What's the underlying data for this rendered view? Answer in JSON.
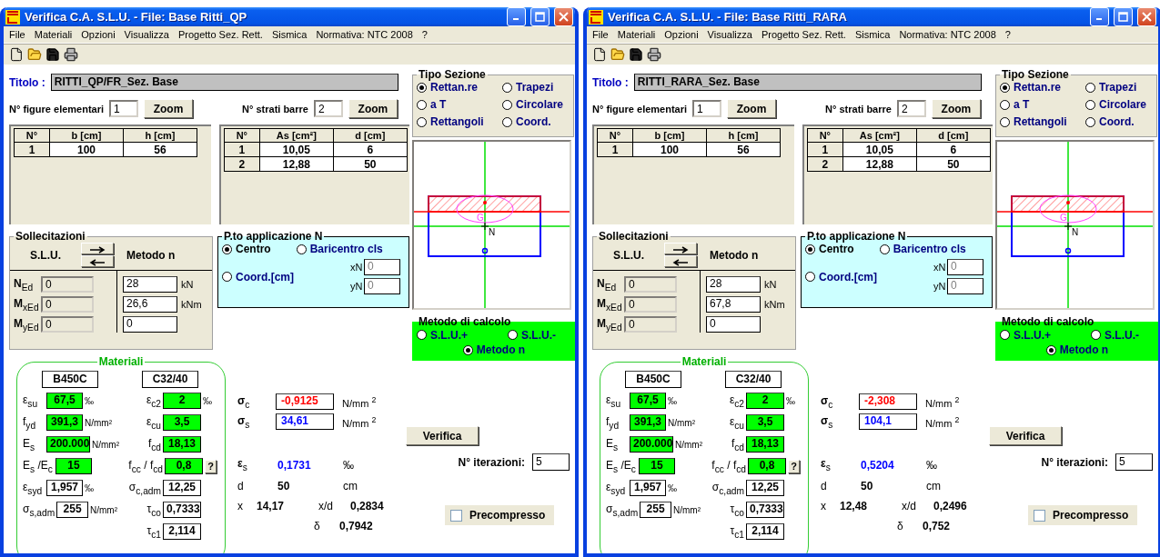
{
  "windows": [
    {
      "title": "Verifica C.A. S.L.U. - File: Base Ritti_QP",
      "menu": [
        "File",
        "Materiali",
        "Opzioni",
        "Visualizza",
        "Progetto Sez. Rett.",
        "Sismica",
        "Normativa: NTC 2008",
        "?"
      ],
      "titolo": {
        "label": "Titolo :",
        "value": "RITTI_QP/FR_Sez. Base"
      },
      "counts": [
        {
          "label": "N° figure elementari",
          "value": "1",
          "button": "Zoom"
        },
        {
          "label": "N° strati barre",
          "value": "2",
          "button": "Zoom"
        }
      ],
      "tables": [
        {
          "columns": [
            "N°",
            "b [cm]",
            "h [cm]"
          ],
          "rows": [
            [
              "1",
              "100",
              "56"
            ]
          ]
        },
        {
          "columns": [
            "N°",
            "As [cm²]",
            "d [cm]"
          ],
          "rows": [
            [
              "1",
              "10,05",
              "6"
            ],
            [
              "2",
              "12,88",
              "50"
            ]
          ]
        }
      ],
      "tipo_sezione": {
        "title": "Tipo Sezione",
        "options": [
          {
            "label": "Rettan.re",
            "selected": true
          },
          {
            "label": "Trapezi",
            "selected": false
          },
          {
            "label": "a T",
            "selected": false
          },
          {
            "label": "Circolare",
            "selected": false
          },
          {
            "label": "Rettangoli",
            "selected": false
          },
          {
            "label": "Coord.",
            "selected": false
          }
        ]
      },
      "sollecitazioni": {
        "title": "Sollecitazioni",
        "left_header": "S.L.U.",
        "right_header": "Metodo n",
        "rows": [
          {
            "label": "N$_{Ed}$",
            "slu": "0",
            "metodo": "28",
            "unit": "kN"
          },
          {
            "label": "M$_{xEd}$",
            "slu": "0",
            "metodo": "26,6",
            "unit": "kNm"
          },
          {
            "label": "M$_{yEd}$",
            "slu": "0",
            "metodo": "0"
          }
        ]
      },
      "applicazione": {
        "title": "P.to applicazione N",
        "options": [
          {
            "label": "Centro",
            "selected": true
          },
          {
            "label": "Baricentro cls",
            "selected": false
          },
          {
            "label": "Coord.[cm]",
            "selected": false
          }
        ],
        "fields": [
          {
            "label": "xN",
            "value": "0"
          },
          {
            "label": "yN",
            "value": "0"
          }
        ]
      },
      "diagram": {
        "centroid_label": "G",
        "load_label": "N"
      },
      "metodo_calcolo": {
        "title": "Metodo di calcolo",
        "options": [
          {
            "label": "S.L.U.+",
            "selected": false
          },
          {
            "label": "S.L.U.-",
            "selected": false
          },
          {
            "label": "Metodo n",
            "selected": true
          }
        ]
      },
      "materiali": {
        "title": "Materiali",
        "columns": [
          {
            "name": "B450C",
            "rows": [
              {
                "label": "ε$_{su}$",
                "value": "67,5",
                "unit": "‰",
                "highlighted": true
              },
              {
                "label": "f$_{yd}$",
                "value": "391,3",
                "unit": "N/mm²",
                "highlighted": true
              },
              {
                "label": "E$_{s}$",
                "value": "200.000",
                "unit": "N/mm²",
                "highlighted": true
              },
              {
                "label": "E$_{s}$ /E$_{c}$",
                "value": "15",
                "highlighted": true
              },
              {
                "label": "ε$_{syd}$",
                "value": "1,957",
                "unit": "‰",
                "highlighted": false
              },
              {
                "label": "σ$_{s,adm}$",
                "value": "255",
                "unit": "N/mm²",
                "highlighted": false
              }
            ]
          },
          {
            "name": "C32/40",
            "rows": [
              {
                "label": "ε$_{c2}$",
                "value": "2",
                "unit": "‰",
                "highlighted": true
              },
              {
                "label": "ε$_{cu}$",
                "value": "3,5",
                "highlighted": true
              },
              {
                "label": "f$_{cd}$",
                "value": "18,13",
                "highlighted": true
              },
              {
                "label": "f$_{cc}$ / f$_{cd}$",
                "value": "0,8",
                "help": "?",
                "highlighted": true
              },
              {
                "label": "σ$_{c,adm}$",
                "value": "12,25",
                "highlighted": false
              },
              {
                "label": "τ$_{co}$",
                "value": "0,7333",
                "highlighted": false
              },
              {
                "label": "τ$_{c1}$",
                "value": "2,114",
                "highlighted": false
              }
            ]
          }
        ]
      },
      "stresses": [
        {
          "label": "σ$_{c}$",
          "value": "-0,9125",
          "unit": "N/mm $^{2}$",
          "color": "#ff0000"
        },
        {
          "label": "σ$_{s}$",
          "value": "34,61",
          "unit": "N/mm $^{2}$",
          "color": "#0000ff"
        }
      ],
      "strain": {
        "label": "ε$_{s}$",
        "value": "0,1731",
        "unit": "‰"
      },
      "depth": {
        "label": "d",
        "value": "50",
        "unit": "cm"
      },
      "neutral_axis": {
        "label": "x",
        "value": "14,17",
        "ratio_label": "x/d",
        "ratio": "0,2834"
      },
      "delta": {
        "label": "δ",
        "value": "0,7942"
      },
      "verifica": "Verifica",
      "iterazioni": {
        "label": "N° iterazioni:",
        "value": "5"
      },
      "precompresso": {
        "label": "Precompresso",
        "checked": false
      }
    },
    {
      "title": "Verifica C.A. S.L.U. - File: Base Ritti_RARA",
      "menu": [
        "File",
        "Materiali",
        "Opzioni",
        "Visualizza",
        "Progetto Sez. Rett.",
        "Sismica",
        "Normativa: NTC 2008",
        "?"
      ],
      "titolo": {
        "label": "Titolo :",
        "value": "RITTI_RARA_Sez. Base"
      },
      "counts": [
        {
          "label": "N° figure elementari",
          "value": "1",
          "button": "Zoom"
        },
        {
          "label": "N° strati barre",
          "value": "2",
          "button": "Zoom"
        }
      ],
      "tables": [
        {
          "columns": [
            "N°",
            "b [cm]",
            "h [cm]"
          ],
          "rows": [
            [
              "1",
              "100",
              "56"
            ]
          ]
        },
        {
          "columns": [
            "N°",
            "As [cm²]",
            "d [cm]"
          ],
          "rows": [
            [
              "1",
              "10,05",
              "6"
            ],
            [
              "2",
              "12,88",
              "50"
            ]
          ]
        }
      ],
      "tipo_sezione": {
        "title": "Tipo Sezione",
        "options": [
          {
            "label": "Rettan.re",
            "selected": true
          },
          {
            "label": "Trapezi",
            "selected": false
          },
          {
            "label": "a T",
            "selected": false
          },
          {
            "label": "Circolare",
            "selected": false
          },
          {
            "label": "Rettangoli",
            "selected": false
          },
          {
            "label": "Coord.",
            "selected": false
          }
        ]
      },
      "sollecitazioni": {
        "title": "Sollecitazioni",
        "left_header": "S.L.U.",
        "right_header": "Metodo n",
        "rows": [
          {
            "label": "N$_{Ed}$",
            "slu": "0",
            "metodo": "28",
            "unit": "kN"
          },
          {
            "label": "M$_{xEd}$",
            "slu": "0",
            "metodo": "67,8",
            "unit": "kNm"
          },
          {
            "label": "M$_{yEd}$",
            "slu": "0",
            "metodo": "0"
          }
        ]
      },
      "applicazione": {
        "title": "P.to applicazione N",
        "options": [
          {
            "label": "Centro",
            "selected": true
          },
          {
            "label": "Baricentro cls",
            "selected": false
          },
          {
            "label": "Coord.[cm]",
            "selected": false
          }
        ],
        "fields": [
          {
            "label": "xN",
            "value": "0"
          },
          {
            "label": "yN",
            "value": "0"
          }
        ]
      },
      "diagram": {
        "centroid_label": "G",
        "load_label": "N"
      },
      "metodo_calcolo": {
        "title": "Metodo di calcolo",
        "options": [
          {
            "label": "S.L.U.+",
            "selected": false
          },
          {
            "label": "S.L.U.-",
            "selected": false
          },
          {
            "label": "Metodo n",
            "selected": true
          }
        ]
      },
      "materiali": {
        "title": "Materiali",
        "columns": [
          {
            "name": "B450C",
            "rows": [
              {
                "label": "ε$_{su}$",
                "value": "67,5",
                "unit": "‰",
                "highlighted": true
              },
              {
                "label": "f$_{yd}$",
                "value": "391,3",
                "unit": "N/mm²",
                "highlighted": true
              },
              {
                "label": "E$_{s}$",
                "value": "200.000",
                "unit": "N/mm²",
                "highlighted": true
              },
              {
                "label": "E$_{s}$ /E$_{c}$",
                "value": "15",
                "highlighted": true
              },
              {
                "label": "ε$_{syd}$",
                "value": "1,957",
                "unit": "‰",
                "highlighted": false
              },
              {
                "label": "σ$_{s,adm}$",
                "value": "255",
                "unit": "N/mm²",
                "highlighted": false
              }
            ]
          },
          {
            "name": "C32/40",
            "rows": [
              {
                "label": "ε$_{c2}$",
                "value": "2",
                "unit": "‰",
                "highlighted": true
              },
              {
                "label": "ε$_{cu}$",
                "value": "3,5",
                "highlighted": true
              },
              {
                "label": "f$_{cd}$",
                "value": "18,13",
                "highlighted": true
              },
              {
                "label": "f$_{cc}$ / f$_{cd}$",
                "value": "0,8",
                "help": "?",
                "highlighted": true
              },
              {
                "label": "σ$_{c,adm}$",
                "value": "12,25",
                "highlighted": false
              },
              {
                "label": "τ$_{co}$",
                "value": "0,7333",
                "highlighted": false
              },
              {
                "label": "τ$_{c1}$",
                "value": "2,114",
                "highlighted": false
              }
            ]
          }
        ]
      },
      "stresses": [
        {
          "label": "σ$_{c}$",
          "value": "-2,308",
          "unit": "N/mm $^{2}$",
          "color": "#ff0000"
        },
        {
          "label": "σ$_{s}$",
          "value": "104,1",
          "unit": "N/mm $^{2}$",
          "color": "#0000ff"
        }
      ],
      "strain": {
        "label": "ε$_{s}$",
        "value": "0,5204",
        "unit": "‰"
      },
      "depth": {
        "label": "d",
        "value": "50",
        "unit": "cm"
      },
      "neutral_axis": {
        "label": "x",
        "value": "12,48",
        "ratio_label": "x/d",
        "ratio": "0,2496"
      },
      "delta": {
        "label": "δ",
        "value": "0,752"
      },
      "verifica": "Verifica",
      "iterazioni": {
        "label": "N° iterazioni:",
        "value": "5"
      },
      "precompresso": {
        "label": "Precompresso",
        "checked": false
      }
    }
  ]
}
